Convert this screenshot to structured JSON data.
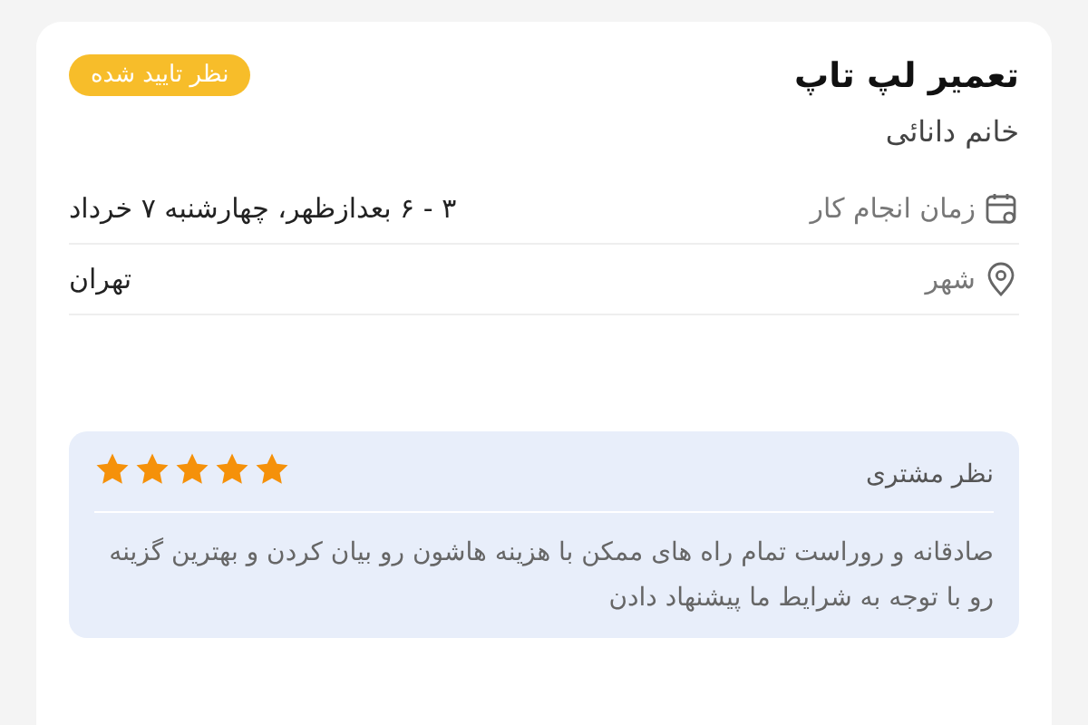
{
  "job": {
    "title": "تعمیر لپ تاپ",
    "customer": "خانم دانائی",
    "badge": "نظر تایید شده"
  },
  "details": [
    {
      "kind": "calendar",
      "label": "زمان انجام کار",
      "value": "۳ - ۶ بعدازظهر، چهارشنبه ۷ خرداد"
    },
    {
      "kind": "location",
      "label": "شهر",
      "value": "تهران"
    }
  ],
  "review": {
    "title": "نظر مشتری",
    "stars": 5,
    "text": "صادقانه و روراست تمام راه های ممکن با هزینه هاشون رو بیان کردن و بهترین گزینه رو با توجه به شرایط ما پیشنهاد دادن"
  }
}
